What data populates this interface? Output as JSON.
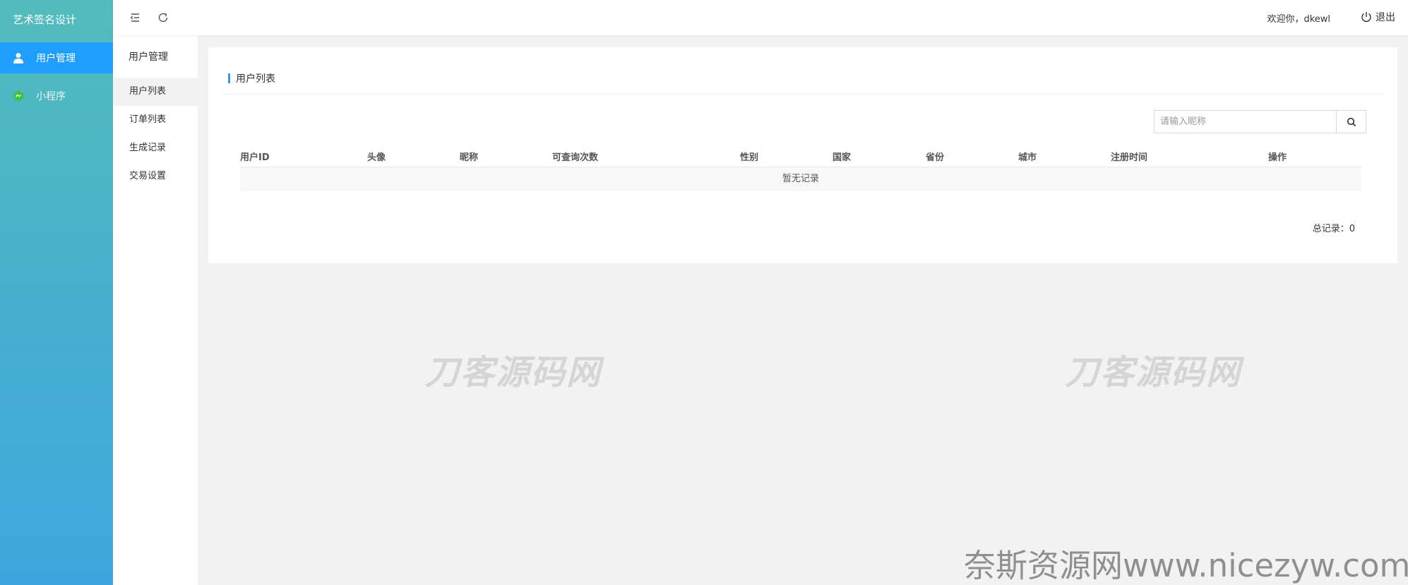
{
  "app": {
    "title": "艺术签名设计"
  },
  "sidebar": {
    "items": [
      {
        "label": "用户管理",
        "active": true
      },
      {
        "label": "小程序",
        "active": false
      }
    ]
  },
  "submenu": {
    "title": "用户管理",
    "items": [
      {
        "label": "用户列表",
        "active": true
      },
      {
        "label": "订单列表",
        "active": false
      },
      {
        "label": "生成记录",
        "active": false
      },
      {
        "label": "交易设置",
        "active": false
      }
    ]
  },
  "header": {
    "welcome": "欢迎你，dkewl",
    "logout_label": "退出"
  },
  "panel": {
    "title": "用户列表",
    "search_placeholder": "请输入昵称",
    "columns": [
      "用户ID",
      "头像",
      "昵称",
      "可查询次数",
      "性别",
      "国家",
      "省份",
      "城市",
      "注册时间",
      "操作"
    ],
    "empty_text": "暂无记录",
    "total_text": "总记录：0"
  },
  "watermarks": {
    "center": "刀客源码网",
    "bottom": "奈斯资源网www.nicezyw.com"
  },
  "colors": {
    "accent": "#1e9fff",
    "sidebar_top": "#52bcbc",
    "sidebar_bottom": "#3ea6de",
    "mini_program_icon": "#3cc23c"
  }
}
